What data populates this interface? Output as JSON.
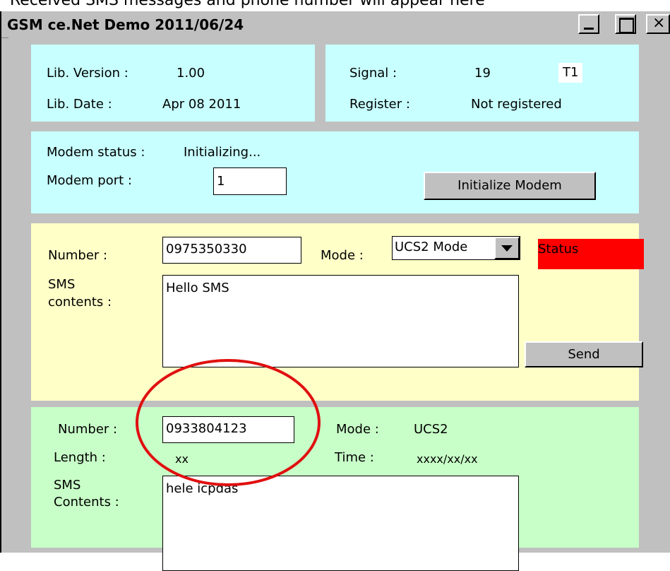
{
  "background_caption": "Received SMS messages and phone number will appear here",
  "window": {
    "title": "GSM ce.Net Demo 2011/06/24"
  },
  "lib_panel": {
    "version_label": "Lib. Version :",
    "version_value": "1.00",
    "date_label": "Lib. Date :",
    "date_value": "Apr 08 2011"
  },
  "signal_panel": {
    "signal_label": "Signal :",
    "signal_value": "19",
    "signal_tag": "T1",
    "register_label": "Register :",
    "register_value": "Not registered"
  },
  "modem_panel": {
    "status_label": "Modem status :",
    "status_value": "Initializing...",
    "port_label": "Modem port :",
    "port_value": "1",
    "init_button": "Initialize Modem"
  },
  "send_panel": {
    "number_label": "Number :",
    "number_value": "0975350330",
    "mode_label": "Mode :",
    "mode_value": "UCS2 Mode",
    "status_text": "Status",
    "sms_label_line1": "SMS",
    "sms_label_line2": "contents :",
    "sms_value": "Hello SMS",
    "send_button": "Send"
  },
  "receive_panel": {
    "number_label": "Number :",
    "number_value": "0933804123",
    "mode_label": "Mode :",
    "mode_value": "UCS2",
    "length_label": "Length :",
    "length_value": "xx",
    "time_label": "Time :",
    "time_value": "xxxx/xx/xx",
    "sms_label_line1": "SMS",
    "sms_label_line2": "Contents :",
    "sms_value": "hele icpdas"
  },
  "colors": {
    "cyan_panel": "#c8ffff",
    "yellow_panel": "#ffffc8",
    "green_panel": "#c8ffc8",
    "status_red": "#ff0000",
    "annotation_circle": "#e01010"
  }
}
